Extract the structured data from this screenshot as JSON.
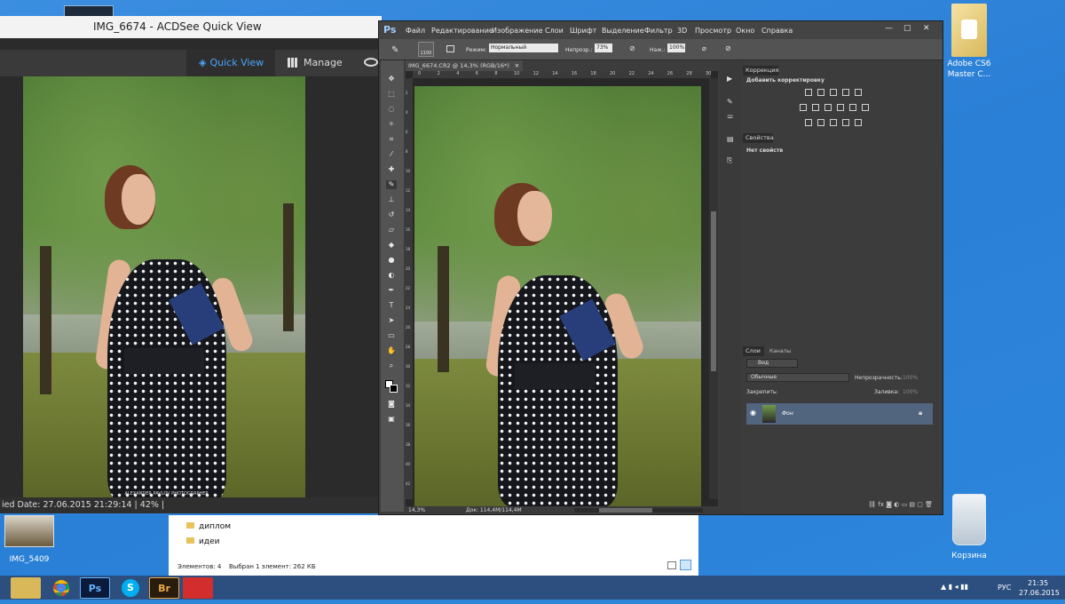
{
  "acdsee": {
    "title": "IMG_6674 - ACDSee Quick View",
    "tab_quickview": "Quick View",
    "tab_manage": "Manage",
    "status": "ied Date: 27.06.2015 21:29:14 | 42% |",
    "watermark": "ALEXANDER PAVLOV PHOTOGRAPHER"
  },
  "photoshop": {
    "logo": "Ps",
    "menu": [
      "Файл",
      "Редактирование",
      "Изображение",
      "Слои",
      "Шрифт",
      "Выделение",
      "Фильтр",
      "3D",
      "Просмотр",
      "Окно",
      "Справка"
    ],
    "options": {
      "brush_size": "1100",
      "mode_label": "Режим:",
      "mode_value": "Нормальный",
      "opacity_label": "Непрозр.:",
      "opacity_value": "73%",
      "flow_label": "Наж.:",
      "flow_value": "100%"
    },
    "doc_tab": "IMG_6674.CR2 @ 14,3% (RGB/16*)",
    "zoom": "14,3%",
    "doc_info": "Док: 114,4M/114,4M",
    "ruler_top": [
      "0",
      "2",
      "4",
      "6",
      "8",
      "10",
      "12",
      "14",
      "16",
      "18",
      "20",
      "22",
      "24",
      "26",
      "28",
      "30"
    ],
    "ruler_left": [
      "2",
      "4",
      "6",
      "8",
      "10",
      "12",
      "14",
      "16",
      "18",
      "20",
      "22",
      "24",
      "26",
      "28",
      "30",
      "32",
      "34",
      "36",
      "38",
      "40",
      "42"
    ],
    "panels": {
      "correction_tab": "Коррекция",
      "correction_title": "Добавить корректировку",
      "properties_tab": "Свойства",
      "properties_text": "Нет свойств",
      "layers_tab": "Слои",
      "channels_tab": "Каналы",
      "kind_label": "Вид",
      "blend_mode": "Обычные",
      "opacity_label": "Непрозрачность:",
      "opacity_value": "100%",
      "lock_label": "Закрепить:",
      "fill_label": "Заливка:",
      "fill_value": "100%",
      "layer_name": "Фон"
    }
  },
  "explorer": {
    "items": [
      "диплом",
      "идеи"
    ],
    "status_count": "Элементов: 4",
    "status_selected": "Выбран 1 элемент: 262 КБ"
  },
  "desktop": {
    "top_right_icon": "Adobe CS6 Master C...",
    "thumb_label": "IMG_5409",
    "recycle": "Корзина"
  },
  "taskbar": {
    "apps": [
      "explorer-icon",
      "chrome-icon",
      "photoshop-icon",
      "skype-icon",
      "bridge-icon",
      "camera-icon"
    ],
    "ps_label": "Ps",
    "skype_label": "S",
    "br_label": "Br",
    "lang": "РУС",
    "time": "21:35",
    "date": "27.06.2015"
  }
}
